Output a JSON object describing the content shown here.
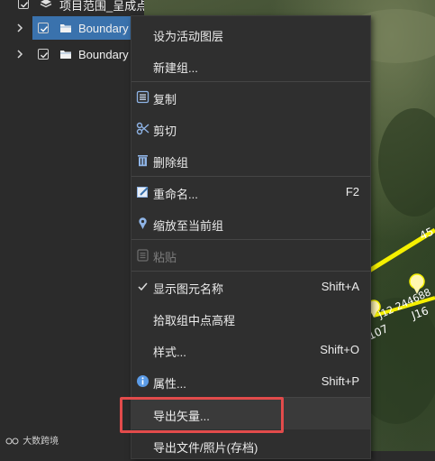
{
  "layer_tree": {
    "root_label": "项目范围_呈成点位_养证...",
    "items": [
      {
        "label": "Boundary",
        "selected": true,
        "checked": true
      },
      {
        "label": "Boundary",
        "selected": false,
        "checked": true
      }
    ]
  },
  "map": {
    "labels": [
      "45",
      "J16",
      "J12  244688",
      "J107"
    ]
  },
  "context_menu": {
    "items": [
      {
        "label": "设为活动图层",
        "shortcut": "",
        "icon": ""
      },
      {
        "label": "新建组...",
        "shortcut": "",
        "icon": ""
      },
      {
        "label": "复制",
        "shortcut": "",
        "icon": "copy-icon"
      },
      {
        "label": "剪切",
        "shortcut": "",
        "icon": "scissors-icon"
      },
      {
        "label": "删除组",
        "shortcut": "",
        "icon": "trash-icon"
      },
      {
        "label": "重命名...",
        "shortcut": "F2",
        "icon": "rename-icon"
      },
      {
        "label": "缩放至当前组",
        "shortcut": "",
        "icon": "zoom-pin-icon"
      },
      {
        "label": "粘贴",
        "shortcut": "",
        "icon": "paste-icon",
        "disabled": true
      },
      {
        "label": "显示图元名称",
        "shortcut": "Shift+A",
        "icon": "checkmark-icon"
      },
      {
        "label": "拾取组中点高程",
        "shortcut": "",
        "icon": ""
      },
      {
        "label": "样式...",
        "shortcut": "Shift+O",
        "icon": ""
      },
      {
        "label": "属性...",
        "shortcut": "Shift+P",
        "icon": "info-icon"
      },
      {
        "label": "导出矢量...",
        "shortcut": "",
        "icon": ""
      },
      {
        "label": "导出文件/照片(存档)",
        "shortcut": "",
        "icon": ""
      }
    ]
  },
  "watermark": "大数跨境",
  "colors": {
    "selection": "#3a72ad",
    "highlight": "#e24b4b",
    "line": "#f5f000",
    "menu_bg": "#2f2f2f"
  }
}
